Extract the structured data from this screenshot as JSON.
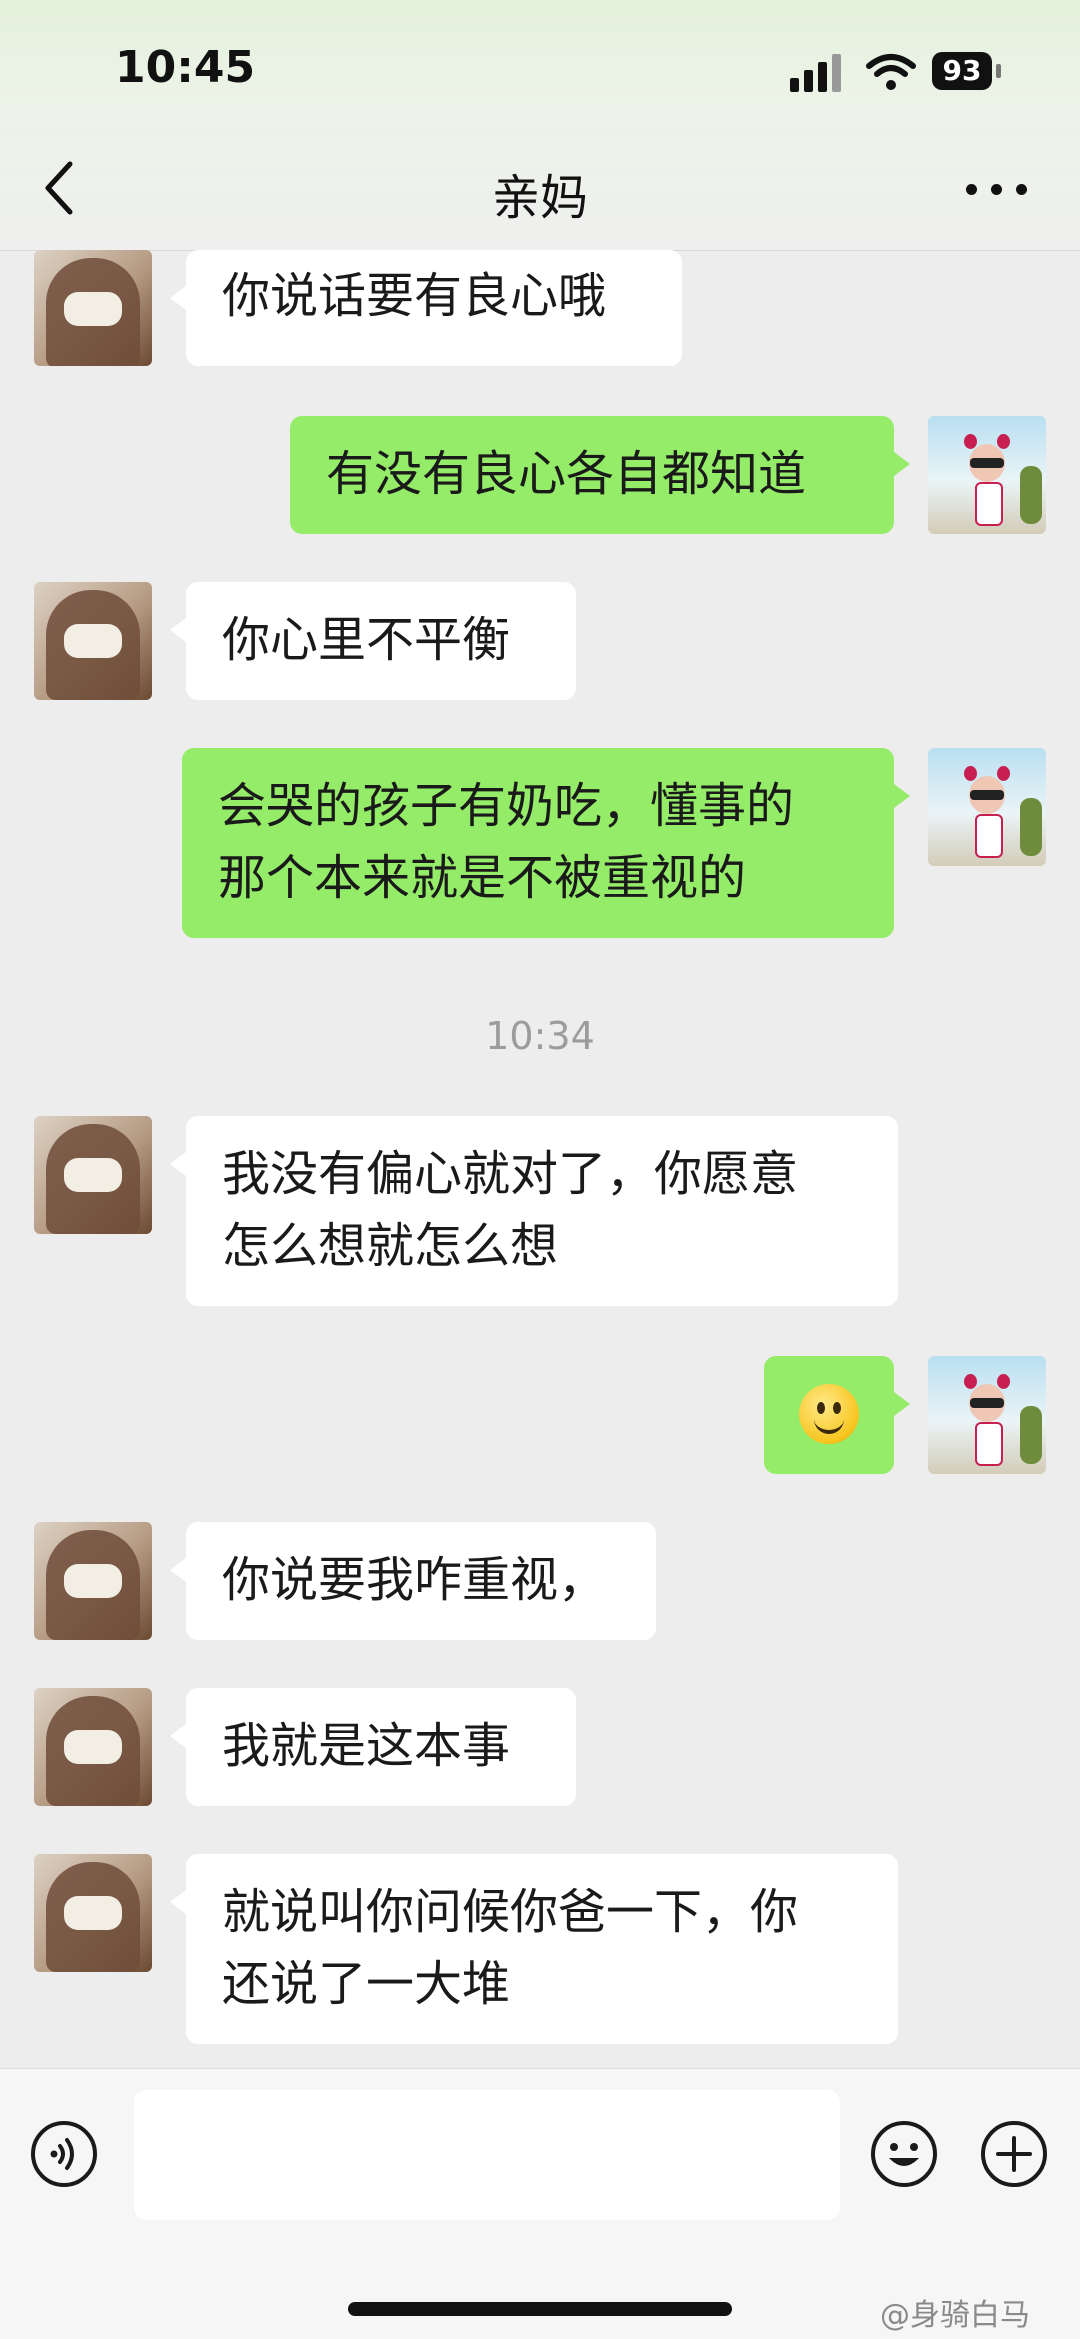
{
  "status_bar": {
    "time": "10:45",
    "battery": "93"
  },
  "header": {
    "title": "亲妈"
  },
  "messages": [
    {
      "side": "left",
      "text": "你说话要有良心哦"
    },
    {
      "side": "right",
      "text": "有没有良心各自都知道"
    },
    {
      "side": "left",
      "text": "你心里不平衡"
    },
    {
      "side": "right",
      "lines": [
        "会哭的孩子有奶吃，懂事的",
        "那个本来就是不被重视的"
      ]
    },
    {
      "side": "left",
      "lines": [
        "我没有偏心就对了，你愿意",
        "怎么想就怎么想"
      ]
    },
    {
      "side": "right",
      "emoji": "smiley-face"
    },
    {
      "side": "left",
      "text": "你说要我咋重视，"
    },
    {
      "side": "left",
      "text": "我就是这本事"
    },
    {
      "side": "left",
      "lines": [
        "就说叫你问候你爸一下，你",
        "还说了一大堆"
      ]
    }
  ],
  "timestamp": "10:34",
  "input_bar": {
    "placeholder": ""
  },
  "watermark": "@身骑白马",
  "colors": {
    "my_bubble": "#95ec69",
    "their_bubble": "#ffffff",
    "background": "#ededed"
  }
}
